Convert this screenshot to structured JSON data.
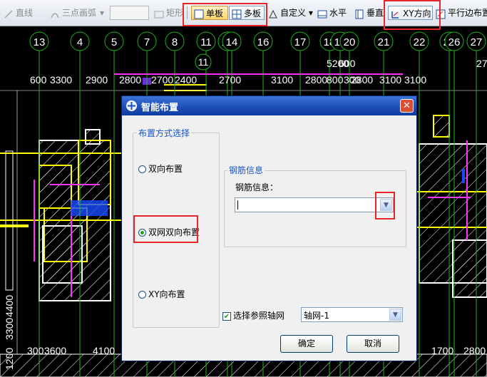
{
  "toolbar": {
    "line": "直线",
    "arc": "三点画弧",
    "rect": "矩形",
    "single": "单板",
    "multi": "多板",
    "custom": "自定义",
    "horizontal": "水平",
    "vertical": "垂直",
    "xy": "XY方向",
    "parallel": "平行边布置"
  },
  "cad": {
    "axis_top": [
      "13",
      "4",
      "5",
      "7",
      "8",
      "11",
      "12",
      "14",
      "16",
      "17",
      "18",
      "19",
      "20",
      "21",
      "22",
      "24",
      "26",
      "27"
    ],
    "axis_sub": "11",
    "dim_top": [
      "600",
      "3300",
      "2900",
      "2800",
      "2700",
      "2400",
      "2700",
      "3100",
      "2800",
      "800",
      "300",
      "2800",
      "3100",
      "3100"
    ],
    "dim_top2": [
      "5200",
      "600"
    ],
    "dim_bottom": [
      "300",
      "3600",
      "4100",
      "1700",
      "2800"
    ],
    "dim_left": [
      "3300",
      "4400",
      "1200"
    ],
    "dim_bottom_right": "27",
    "colors": {
      "axis": "#1fb31f",
      "wall": "#ffff00",
      "beam": "#ff33ff",
      "slab": "#ffffff",
      "dim": "#ffffff"
    }
  },
  "dialog": {
    "title": "智能布置",
    "mode_group": "布置方式选择",
    "options": [
      "双向布置",
      "双网双向布置",
      "XY向布置"
    ],
    "selected": "双网双向布置",
    "rebar_group": "钢筋信息",
    "rebar_label": "钢筋信息：",
    "rebar_value": "",
    "ref_axis_checkbox": "选择参照轴网",
    "ref_axis_checked": true,
    "axis_value": "轴网-1",
    "ok": "确定",
    "cancel": "取消"
  }
}
